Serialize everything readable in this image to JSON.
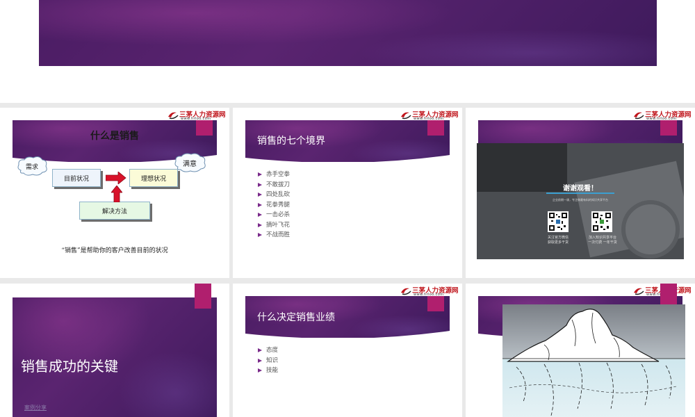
{
  "slide1": {
    "title": "什么是销售",
    "cloud_need": "需求",
    "cloud_satisfy": "满意",
    "box_current": "目前状况",
    "box_ideal": "理想状况",
    "box_solution": "解决方法",
    "caption": "“销售”是帮助你的客户改善目前的状况"
  },
  "slide2": {
    "title": "销售的七个境界",
    "items": [
      "赤手空拳",
      "不敢拔刀",
      "四处乱砍",
      "花拳秀腿",
      "一击必杀",
      "摘叶飞花",
      "不战而胜"
    ]
  },
  "slide3": {
    "thanks_title": "谢谢观看！",
    "thanks_sub": "企业前期一课，专注做最有料的知识共享平台",
    "qr_left_caption": [
      "关注官方微信",
      "获取更多干货"
    ],
    "qr_right_caption": [
      "加入知识共享平台",
      "一次付费 一年干货"
    ]
  },
  "slide4": {
    "title": "销售成功的关键",
    "link": "案例分享"
  },
  "slide5": {
    "title": "什么决定销售业绩",
    "items": [
      "态度",
      "知识",
      "技能"
    ]
  },
  "logo": {
    "name": "三茅人力资源网",
    "url": "www.hrloo.com"
  },
  "colors": {
    "purple": "#4a1c63",
    "accent_tab": "#b01f6e",
    "bullet": "#7a2a8a"
  }
}
